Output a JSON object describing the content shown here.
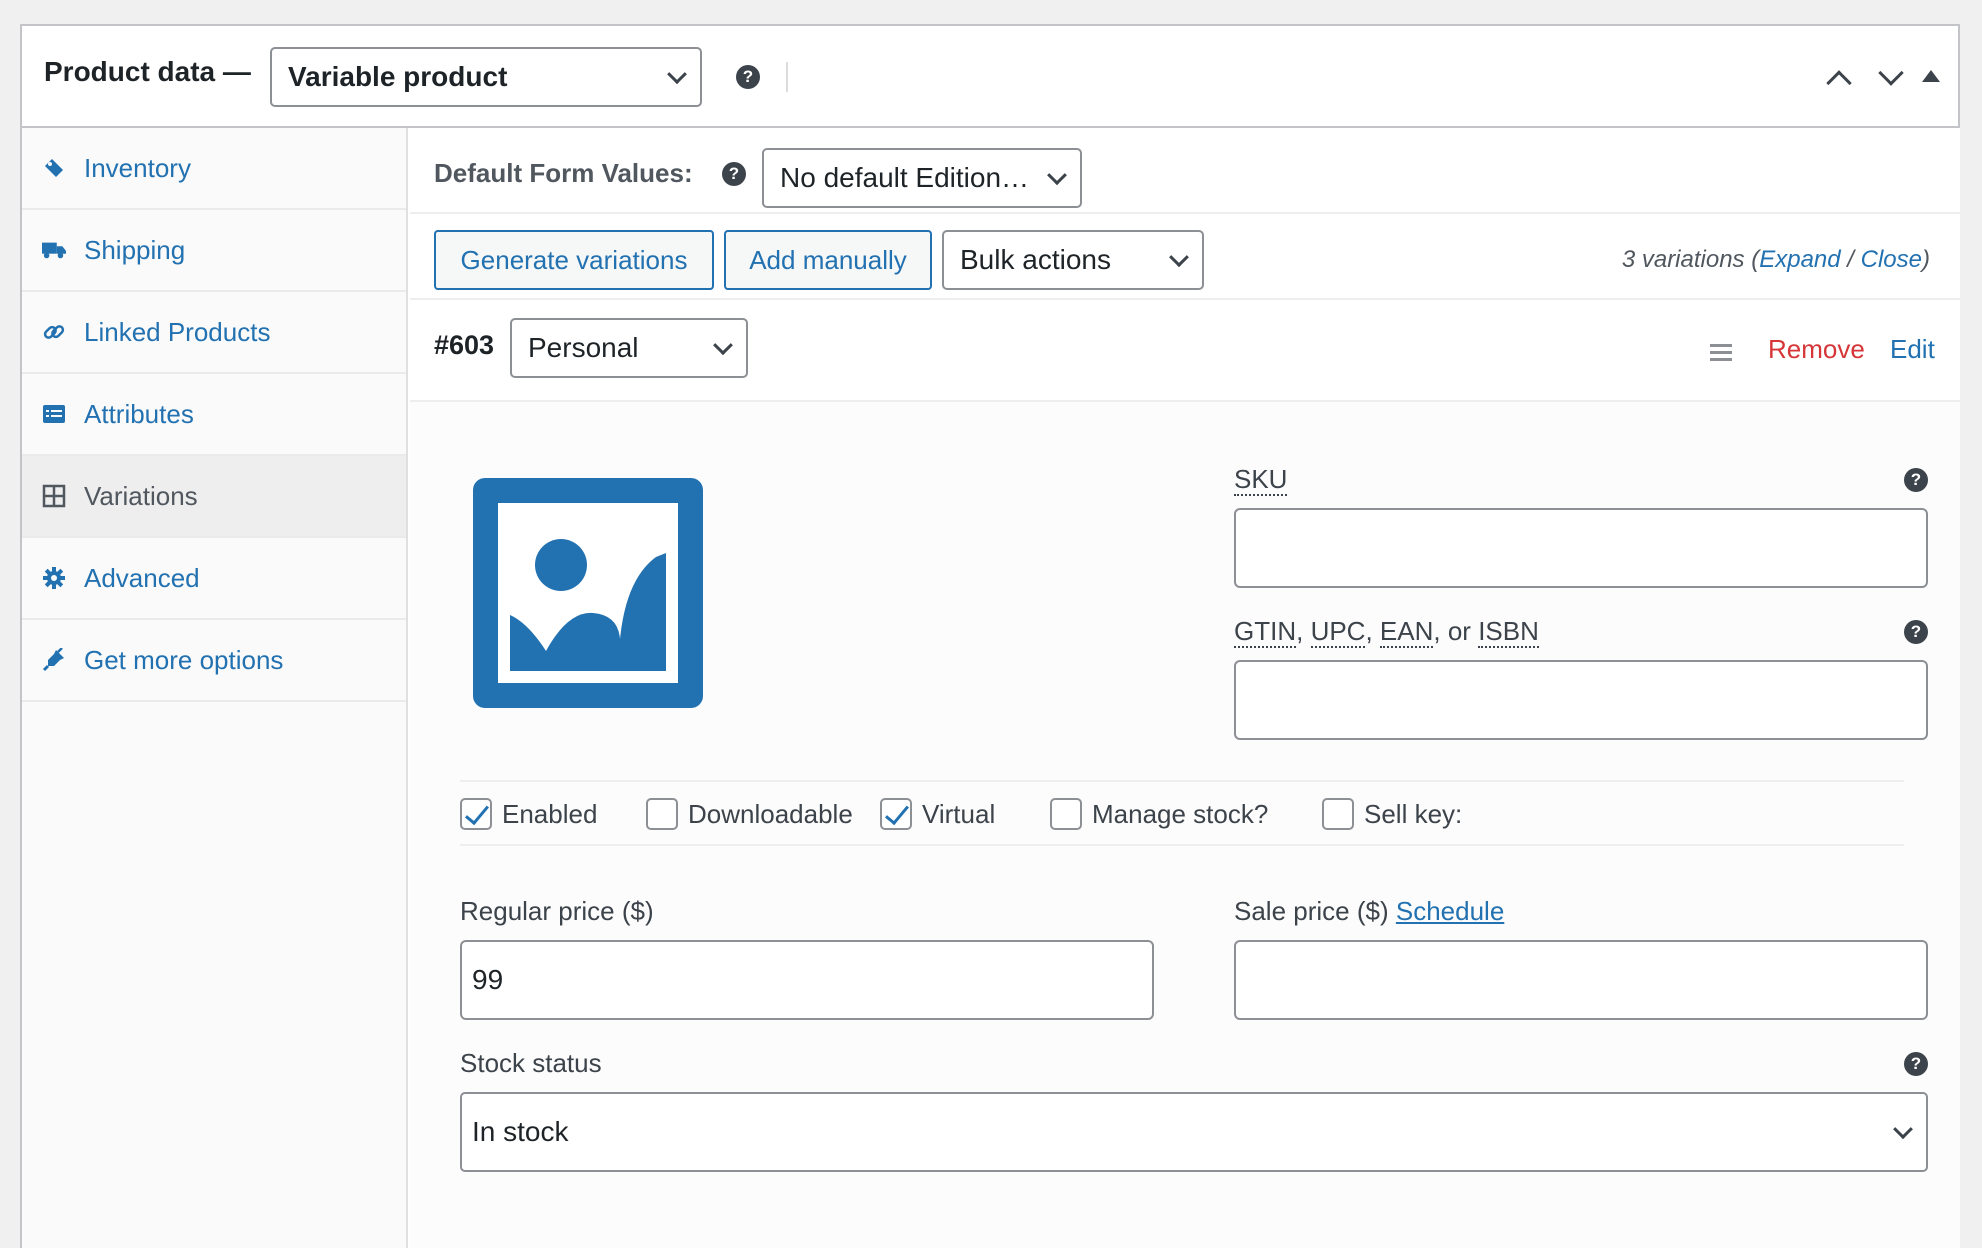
{
  "header": {
    "title": "Product data —",
    "product_type": "Variable product",
    "help": "?",
    "colors": {
      "accent": "#2271b1",
      "danger": "#d63638",
      "border": "#c3c4c7"
    }
  },
  "sidebar": {
    "items": [
      {
        "label": "Inventory",
        "icon": "tag-icon"
      },
      {
        "label": "Shipping",
        "icon": "truck-icon"
      },
      {
        "label": "Linked Products",
        "icon": "link-icon"
      },
      {
        "label": "Attributes",
        "icon": "list-icon"
      },
      {
        "label": "Variations",
        "icon": "grid-icon",
        "active": true
      },
      {
        "label": "Advanced",
        "icon": "gear-icon"
      },
      {
        "label": "Get more options",
        "icon": "plugin-icon"
      }
    ]
  },
  "defaults": {
    "label": "Default Form Values:",
    "value": "No default Edition…"
  },
  "actions": {
    "generate": "Generate variations",
    "add": "Add manually",
    "bulk": "Bulk actions",
    "count_text": "3 variations (",
    "expand": "Expand",
    "slash": " / ",
    "close": "Close",
    "close_paren": ")"
  },
  "variation": {
    "id": "#603",
    "attribute_value": "Personal",
    "remove": "Remove",
    "edit": "Edit",
    "sku_label": "SKU",
    "sku_value": "",
    "gtin_parts": [
      "GTIN",
      ", ",
      "UPC",
      ", ",
      "EAN",
      ", or ",
      "ISBN"
    ],
    "gtin_value": "",
    "checkboxes": [
      {
        "label": "Enabled",
        "checked": true
      },
      {
        "label": "Downloadable",
        "checked": false
      },
      {
        "label": "Virtual",
        "checked": true
      },
      {
        "label": "Manage stock?",
        "checked": false
      },
      {
        "label": "Sell key:",
        "checked": false
      }
    ],
    "regular_price_label": "Regular price ($)",
    "regular_price_value": "99",
    "sale_price_label": "Sale price ($)",
    "schedule": "Schedule",
    "sale_price_value": "",
    "stock_status_label": "Stock status",
    "stock_status_value": "In stock"
  }
}
